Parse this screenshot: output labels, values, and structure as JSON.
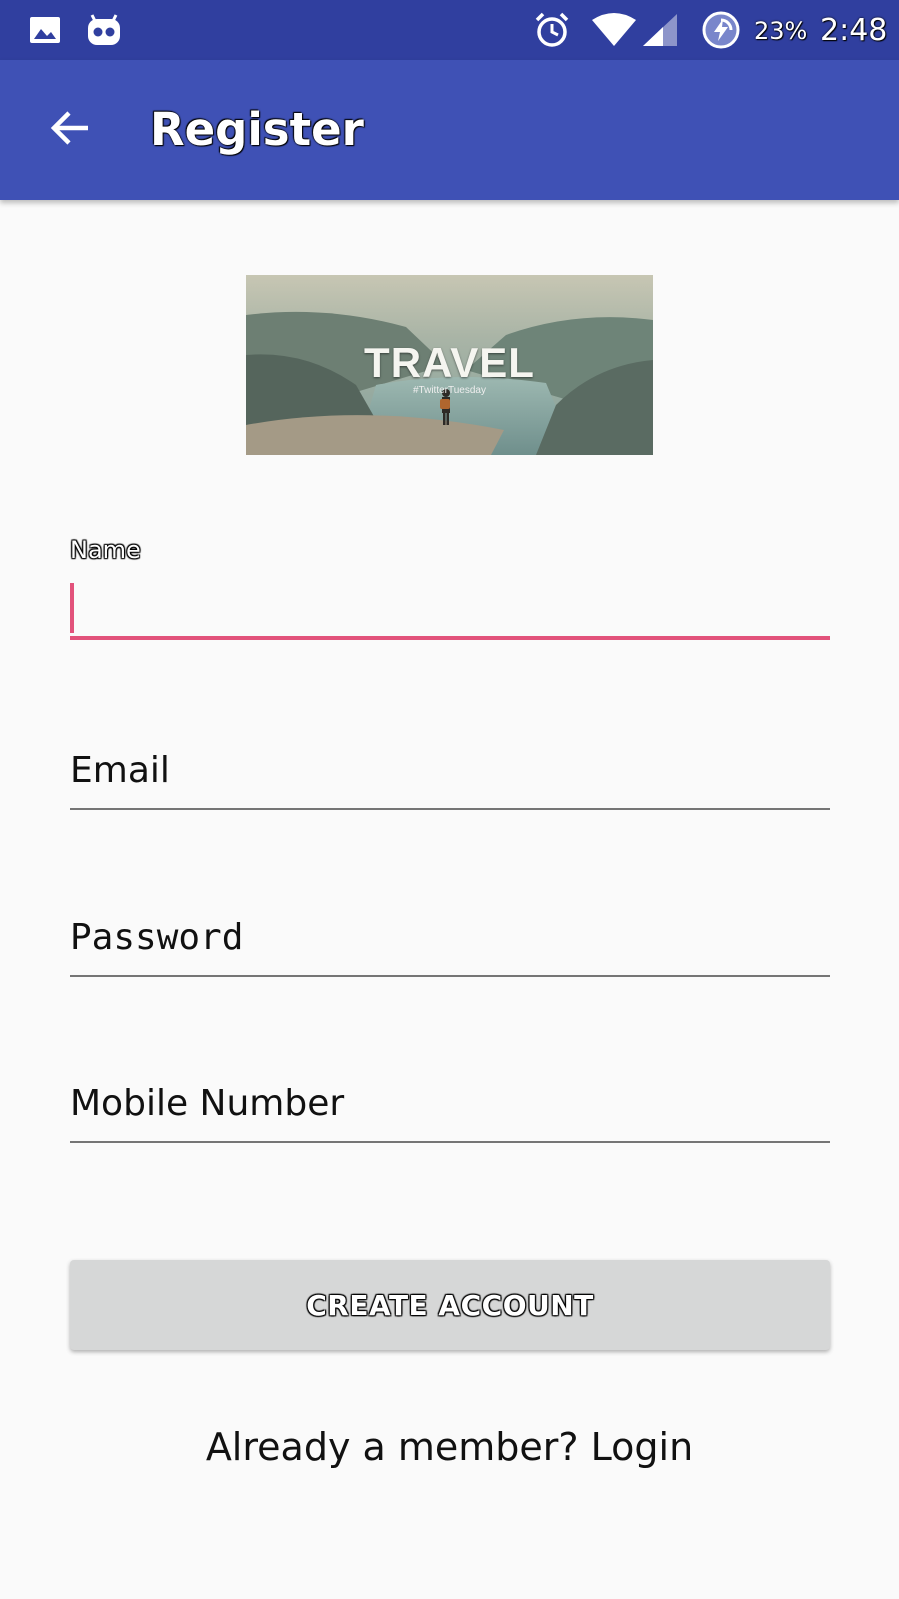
{
  "status_bar": {
    "battery_percent": "23%",
    "time": "2:48",
    "icons": [
      "image-icon",
      "robot-icon",
      "alarm-icon",
      "wifi-icon",
      "signal-icon",
      "battery-charging-icon"
    ]
  },
  "app_bar": {
    "title": "Register",
    "back_icon": "arrow-back-icon"
  },
  "banner": {
    "title": "TRAVEL",
    "subtitle": "#TwitterTuesday"
  },
  "form": {
    "name": {
      "label": "Name",
      "value": ""
    },
    "email": {
      "placeholder": "Email",
      "value": ""
    },
    "password": {
      "placeholder": "Password",
      "value": ""
    },
    "mobile": {
      "placeholder": "Mobile Number",
      "value": ""
    },
    "submit_label": "CREATE ACCOUNT",
    "login_text": "Already a member? Login"
  },
  "colors": {
    "primary": "#3f51b5",
    "primary_dark": "#303f9f",
    "accent": "#e2527b",
    "background": "#fafafa",
    "button_bg": "#d6d7d7"
  }
}
